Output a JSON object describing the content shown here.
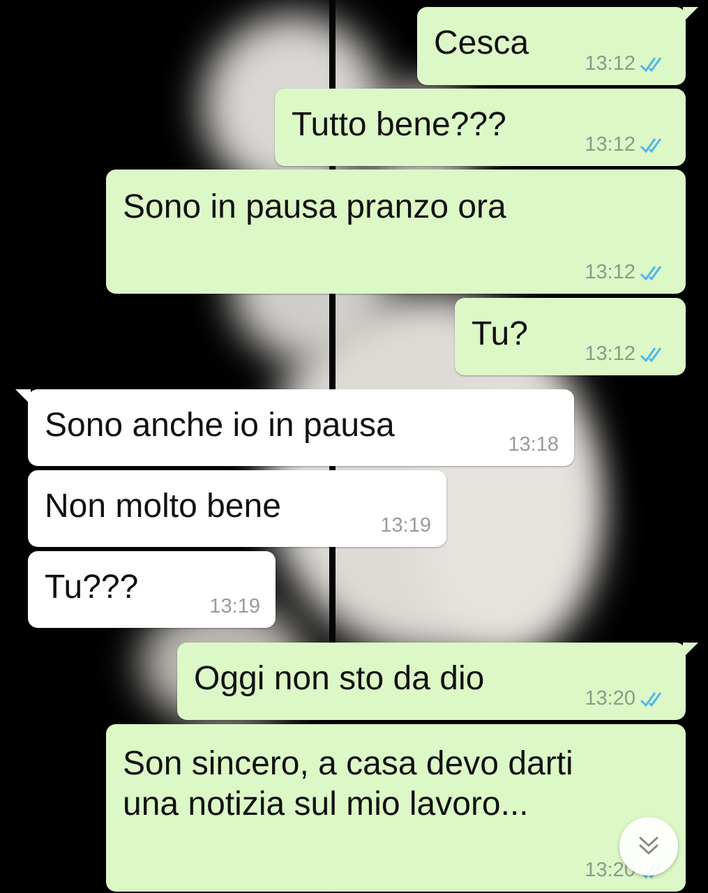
{
  "colors": {
    "outgoing": "#dcf8c6",
    "incoming": "#ffffff",
    "read_ticks": "#4fb6ec"
  },
  "messages": [
    {
      "dir": "out",
      "text": "Cesca",
      "time": "13:12",
      "status": "read",
      "icon": "double-check-icon"
    },
    {
      "dir": "out",
      "text": "Tutto bene???",
      "time": "13:12",
      "status": "read",
      "icon": "double-check-icon"
    },
    {
      "dir": "out",
      "text": "Sono in pausa pranzo ora",
      "time": "13:12",
      "status": "read",
      "icon": "double-check-icon"
    },
    {
      "dir": "out",
      "text": "Tu?",
      "time": "13:12",
      "status": "read",
      "icon": "double-check-icon"
    },
    {
      "dir": "in",
      "text": "Sono anche io in pausa",
      "time": "13:18"
    },
    {
      "dir": "in",
      "text": "Non molto bene",
      "time": "13:19"
    },
    {
      "dir": "in",
      "text": "Tu???",
      "time": "13:19"
    },
    {
      "dir": "out",
      "text": "Oggi non sto da dio",
      "time": "13:20",
      "status": "read",
      "icon": "double-check-icon"
    },
    {
      "dir": "out",
      "text": "Son sincero, a casa devo darti\nuna notizia sul mio lavoro...",
      "time": "13:20",
      "status": "read",
      "icon": "double-check-icon"
    }
  ],
  "scroll_button": {
    "icon": "double-chevron-down-icon"
  }
}
